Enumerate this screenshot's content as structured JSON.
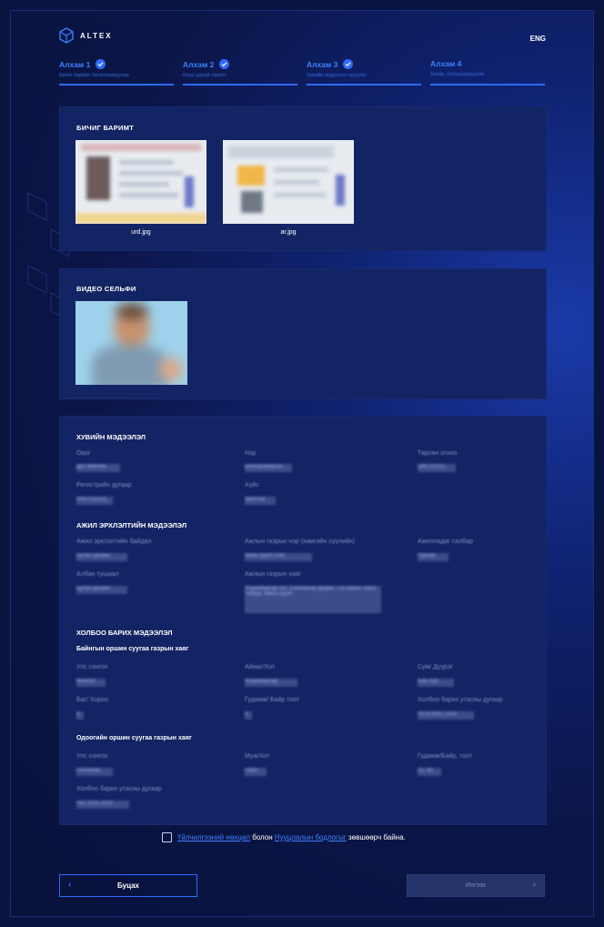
{
  "brand": {
    "name": "ALTEX"
  },
  "header": {
    "lang": "ENG"
  },
  "steps": [
    {
      "title": "Алхам 1",
      "sub": "Бичиг баримт баталгаажуулах",
      "done": true
    },
    {
      "title": "Алхам 2",
      "sub": "Нүүр царай танилт",
      "done": true
    },
    {
      "title": "Алхам 3",
      "sub": "Хувийн мэдээлэл оруулах",
      "done": true
    },
    {
      "title": "Алхам 4",
      "sub": "Хянах, баталгаажуулах",
      "done": false
    }
  ],
  "documents": {
    "title": "БИЧИГ БАРИМТ",
    "files": [
      {
        "name": "urd.jpg"
      },
      {
        "name": "ar.jpg"
      }
    ]
  },
  "selfie": {
    "title": "ВИДЕО СЕЛЬФИ"
  },
  "personal": {
    "title": "ХУВИЙН МЭДЭЭЛЭЛ",
    "surname_label": "Овог",
    "surname_value": "Дот-Мөнгөн",
    "name_label": "Нэр",
    "name_value": "Билгүүнжаргал",
    "birth_label": "Төрсөн огноо",
    "birth_value": "1997/01/01",
    "regnum_label": "Регистрийн дугаар",
    "regnum_value": "УА97010111",
    "gender_label": "Хүйс",
    "gender_value": "Эрэгтэй"
  },
  "work": {
    "title": "АЖИЛ ЭРХЛЭЛТИЙН МЭДЭЭЛЭЛ",
    "status_label": "Ажил эрхлэлтийн байдал",
    "status_value": "Бүтэн цагийн",
    "company_label": "Ажлын газрын нэр (хамгийн сүүлийн)",
    "company_value": "Мика групп ХХК",
    "sector_label": "Ажилладаг салбар",
    "sector_value": "Уурхай",
    "position_label": "Албан тушаал",
    "position_value": "Бүтэн цагийн",
    "address_label": "Ажлын газрын хаяг",
    "address_value": "Улаанбаатар хот, Сүхбаатар дүүрэг, 1-р хороо, Бага тойруу, Мика групп"
  },
  "contact": {
    "title": "ХОЛБОО БАРИХ МЭДЭЭЛЭЛ",
    "permanent_title": "Байнгын оршин суугаа газрын хаяг",
    "country_label": "Улс сонгох",
    "country_value": "Монгол",
    "province_label": "Аймаг/Хот",
    "province_value": "Улаанбаатар",
    "soum_label": "Сум/ Дүүрэг",
    "soum_value": "Хан-Уул",
    "bag_label": "Баг/ Хороо",
    "bag_value": "5",
    "street_label": "Гудамж/ Байр тоот",
    "street_value": "5",
    "phone_label": "Холбоо барих утасны дугаар",
    "phone_value": "+976 9911 2233",
    "current_title": "Одоогийн оршин суугаа газрын хаяг",
    "cur_country_label": "Улс сонгох",
    "cur_country_value": "Солонгос",
    "cur_state_label": "Муж/Хот",
    "cur_state_value": "Сөүл",
    "cur_street_label": "Гудамж/Байр, тоот",
    "cur_street_value": "15, 45",
    "cur_phone_label": "Холбоо барих утасны дугаар",
    "cur_phone_value": "+82 1011 2233"
  },
  "agreement": {
    "terms_link": "Үйлчилгээний нөхцөл",
    "joiner": "болон",
    "privacy_link": "Нууцлалын бодлогыг",
    "tail": "зөвшөөрч байна."
  },
  "buttons": {
    "back": "Буцах",
    "send": "Илгээх"
  },
  "colors": {
    "accent": "#2d6bff",
    "card": "#132464",
    "bg": "#0a1440"
  }
}
